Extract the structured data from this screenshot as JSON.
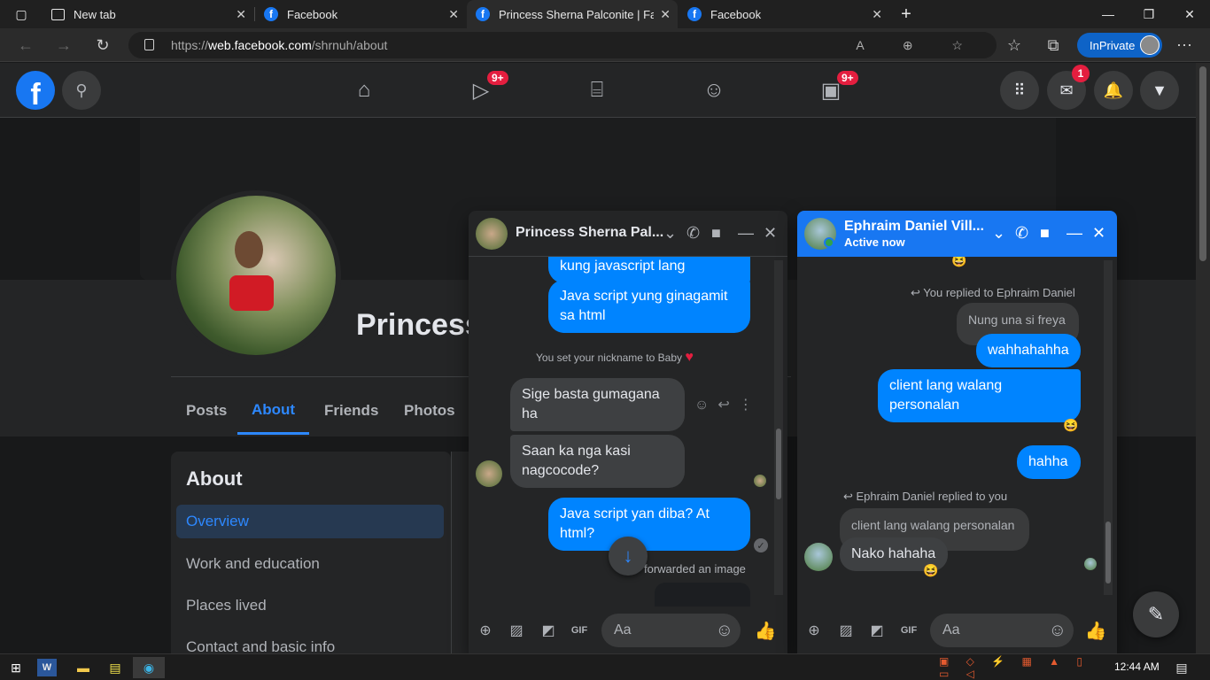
{
  "browser": {
    "tabs": [
      {
        "label": "New tab"
      },
      {
        "label": "Facebook"
      },
      {
        "label": "Princess Sherna Palconite | Faceb"
      },
      {
        "label": "Facebook"
      }
    ],
    "url_prefix": "https://",
    "url_host": "web.facebook.com",
    "url_path": "/shrnuh/about",
    "inprivate_label": "InPrivate"
  },
  "fb_header": {
    "watch_badge": "9+",
    "gaming_badge": "9+",
    "messenger_badge": "1"
  },
  "profile": {
    "name": "Princess",
    "tabs": [
      "Posts",
      "About",
      "Friends",
      "Photos"
    ],
    "active_tab": "About"
  },
  "about": {
    "title": "About",
    "items": [
      "Overview",
      "Work and education",
      "Places lived",
      "Contact and basic info"
    ]
  },
  "chat1": {
    "name": "Princess Sherna Pal...",
    "messages": {
      "m1": "kung javascript lang",
      "m2": "Java script yung ginagamit sa html",
      "sys1": "You set your nickname to Baby",
      "m3": "Sige basta gumagana ha",
      "m4": "Saan ka nga kasi nagcocode?",
      "m5": "Java script yan diba? At html?",
      "sys2": "forwarded an image"
    },
    "composer_placeholder": "Aa"
  },
  "chat2": {
    "name": "Ephraim Daniel Vill...",
    "status": "Active now",
    "messages": {
      "sys1": "You replied to Ephraim Daniel",
      "quoted1": "Nung una si freya",
      "m1": "wahhahahha",
      "m2": "client lang walang personalan",
      "m3": "hahha",
      "sys2": "Ephraim Daniel replied to you",
      "quoted2": "client lang walang personalan",
      "m4": "Nako hahaha"
    },
    "composer_placeholder": "Aa"
  },
  "taskbar": {
    "time": "12:44 AM"
  },
  "colors": {
    "fb_blue": "#1877f2",
    "messenger_blue": "#0084ff",
    "dark_bg": "#18191a",
    "card_bg": "#242526"
  }
}
